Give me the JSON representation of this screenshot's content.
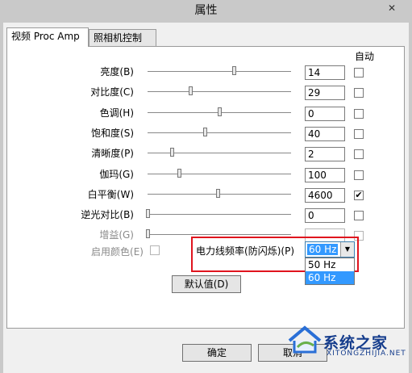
{
  "window": {
    "title": "属性",
    "close_label": "✕"
  },
  "tabs": [
    {
      "label": "视频 Proc Amp"
    },
    {
      "label": "照相机控制"
    }
  ],
  "auto_header": "自动",
  "rows": [
    {
      "label": "亮度(B)",
      "value": "14",
      "slider_fraction": 0.6,
      "auto": false,
      "enabled": true
    },
    {
      "label": "对比度(C)",
      "value": "29",
      "slider_fraction": 0.3,
      "auto": false,
      "enabled": true
    },
    {
      "label": "色调(H)",
      "value": "0",
      "slider_fraction": 0.5,
      "auto": false,
      "enabled": true
    },
    {
      "label": "饱和度(S)",
      "value": "40",
      "slider_fraction": 0.4,
      "auto": false,
      "enabled": true
    },
    {
      "label": "清晰度(P)",
      "value": "2",
      "slider_fraction": 0.17,
      "auto": false,
      "enabled": true
    },
    {
      "label": "伽玛(G)",
      "value": "100",
      "slider_fraction": 0.22,
      "auto": false,
      "enabled": true
    },
    {
      "label": "白平衡(W)",
      "value": "4600",
      "slider_fraction": 0.49,
      "auto": true,
      "enabled": true
    },
    {
      "label": "逆光对比(B)",
      "value": "0",
      "slider_fraction": 0.0,
      "auto": false,
      "enabled": true
    },
    {
      "label": "增益(G)",
      "value": "",
      "slider_fraction": 0.0,
      "auto": false,
      "enabled": false
    }
  ],
  "color_enable": {
    "label": "启用颜色(E)",
    "checked": false
  },
  "powerline": {
    "label": "电力线频率(防闪烁)(P)",
    "selected": "60 Hz",
    "options": [
      "50 Hz",
      "60 Hz"
    ]
  },
  "default_button": "默认值(D)",
  "ok_button": "确定",
  "cancel_button": "取消",
  "watermark": {
    "text": "系统之家",
    "sub": "XITONGZHIJIA.NET"
  }
}
